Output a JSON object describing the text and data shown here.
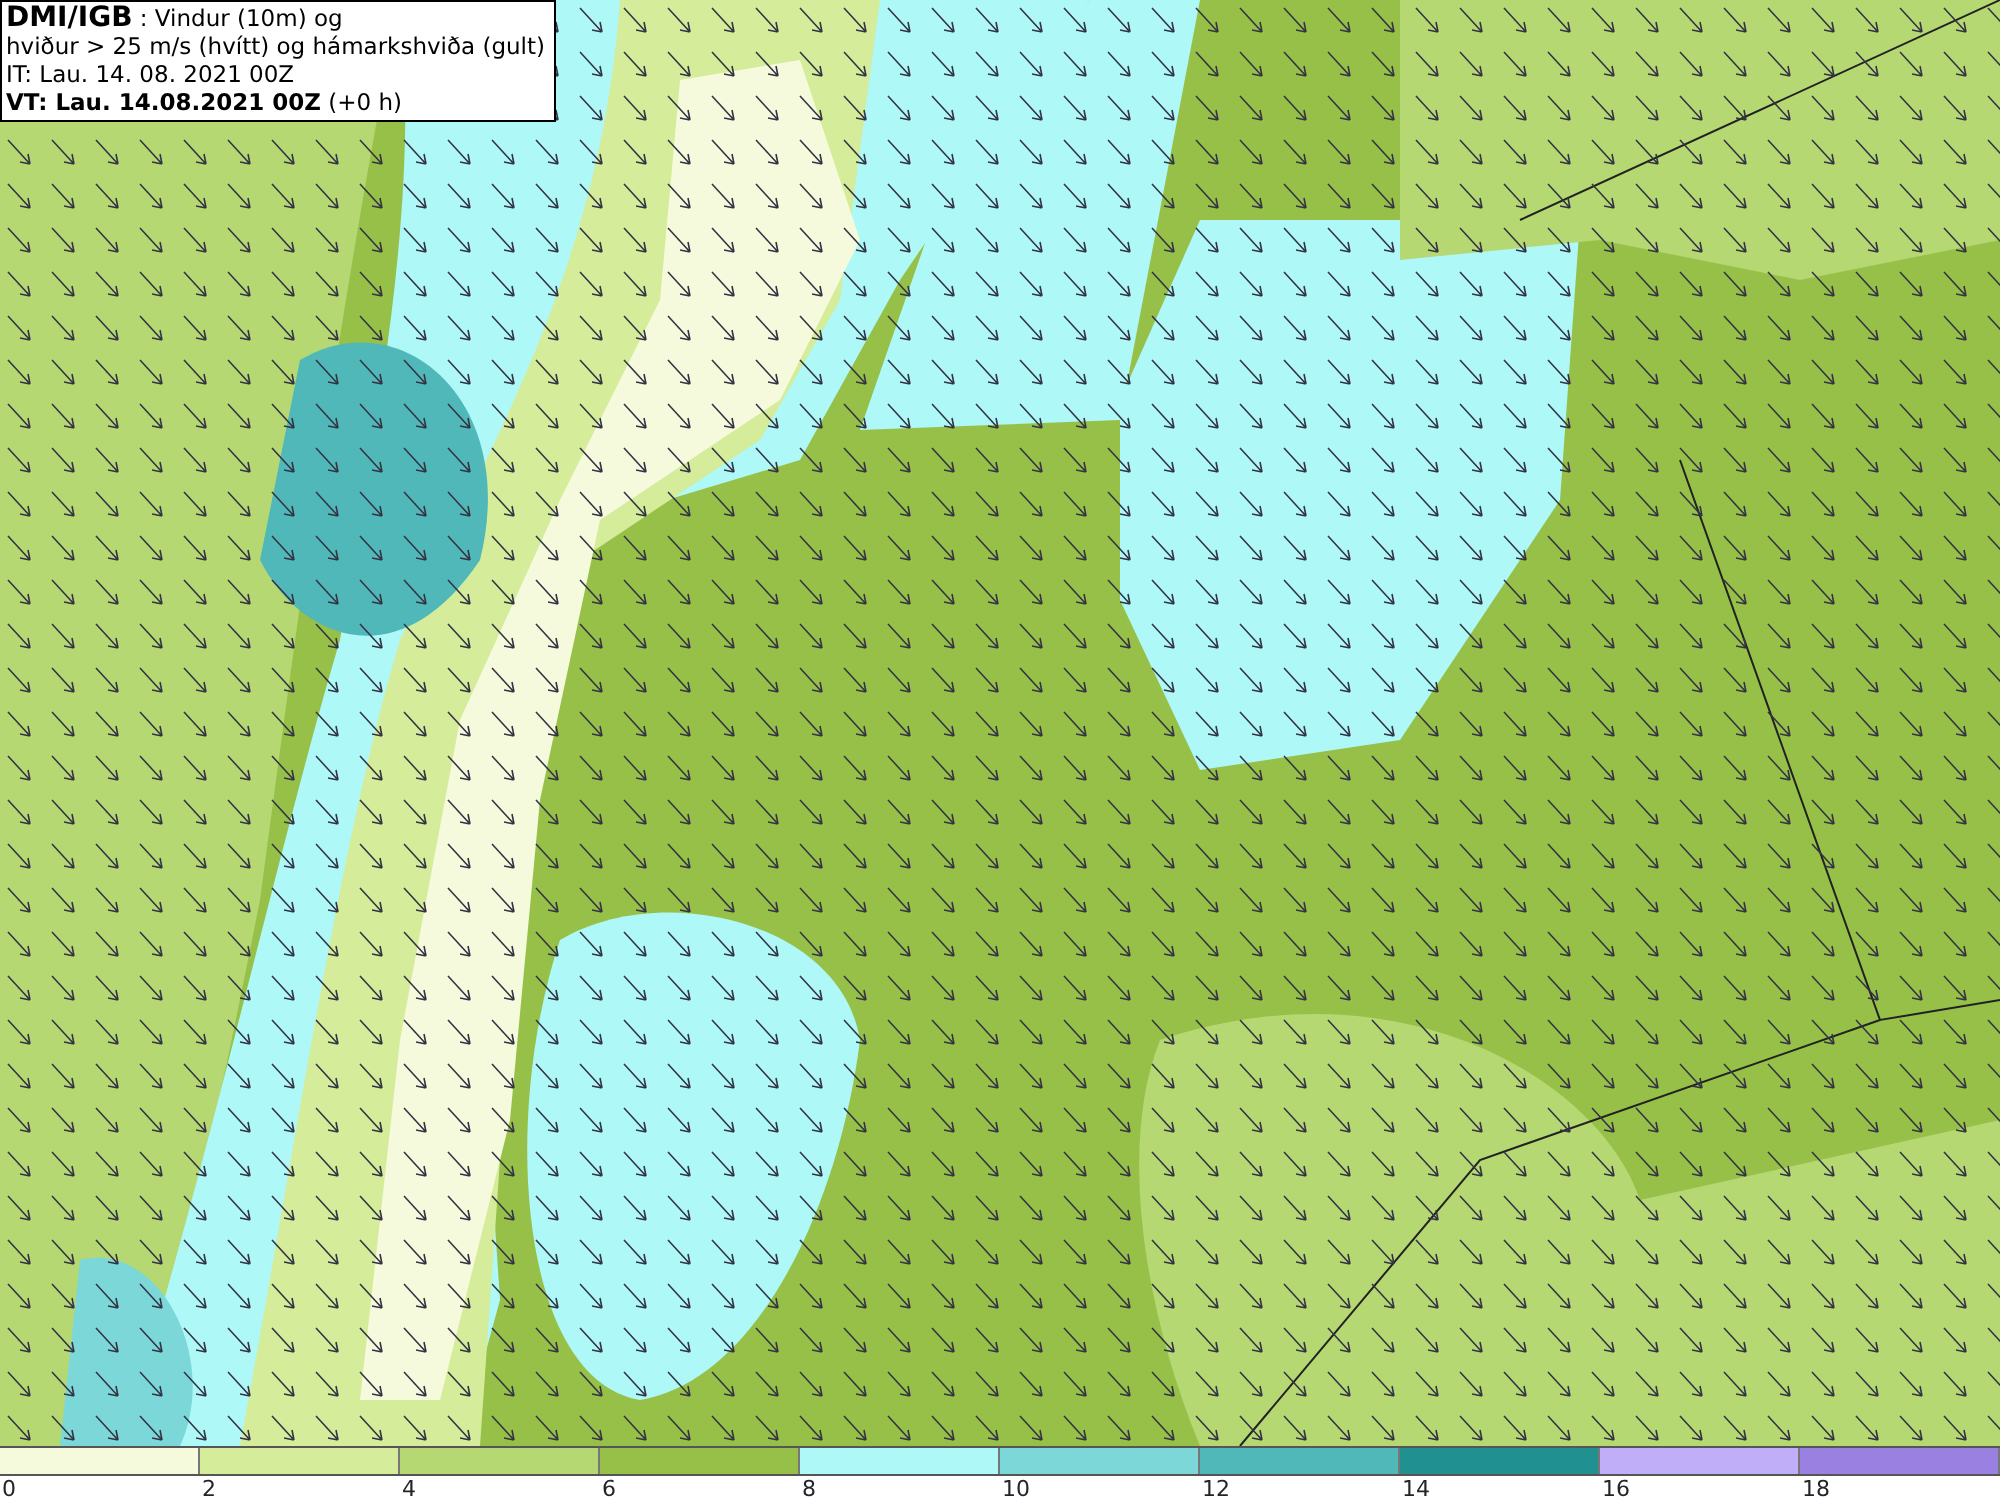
{
  "title_box": {
    "lines": [
      "**DMI/IGB** : Vindur (10m) og",
      "hviður > 25 m/s (hvítt) og hámarkshviða (gult)",
      "IT: Lau. 14. 08. 2021 00Z",
      "**VT: Lau. 14.08.2021 00Z** (+0 h)"
    ]
  },
  "legend": {
    "swatches": [
      {
        "color": "#f5fadc"
      },
      {
        "color": "#d5ec9a"
      },
      {
        "color": "#b5d872"
      },
      {
        "color": "#96c048"
      },
      {
        "color": "#aef8f8"
      },
      {
        "color": "#7cd8d8"
      },
      {
        "color": "#50b8b8"
      },
      {
        "color": "#219090"
      },
      {
        "color": "#c0aef8"
      },
      {
        "color": "#9a80e0"
      }
    ],
    "labels": [
      "0",
      "2",
      "4",
      "6",
      "8",
      "10",
      "12",
      "14",
      "16",
      "18"
    ]
  }
}
